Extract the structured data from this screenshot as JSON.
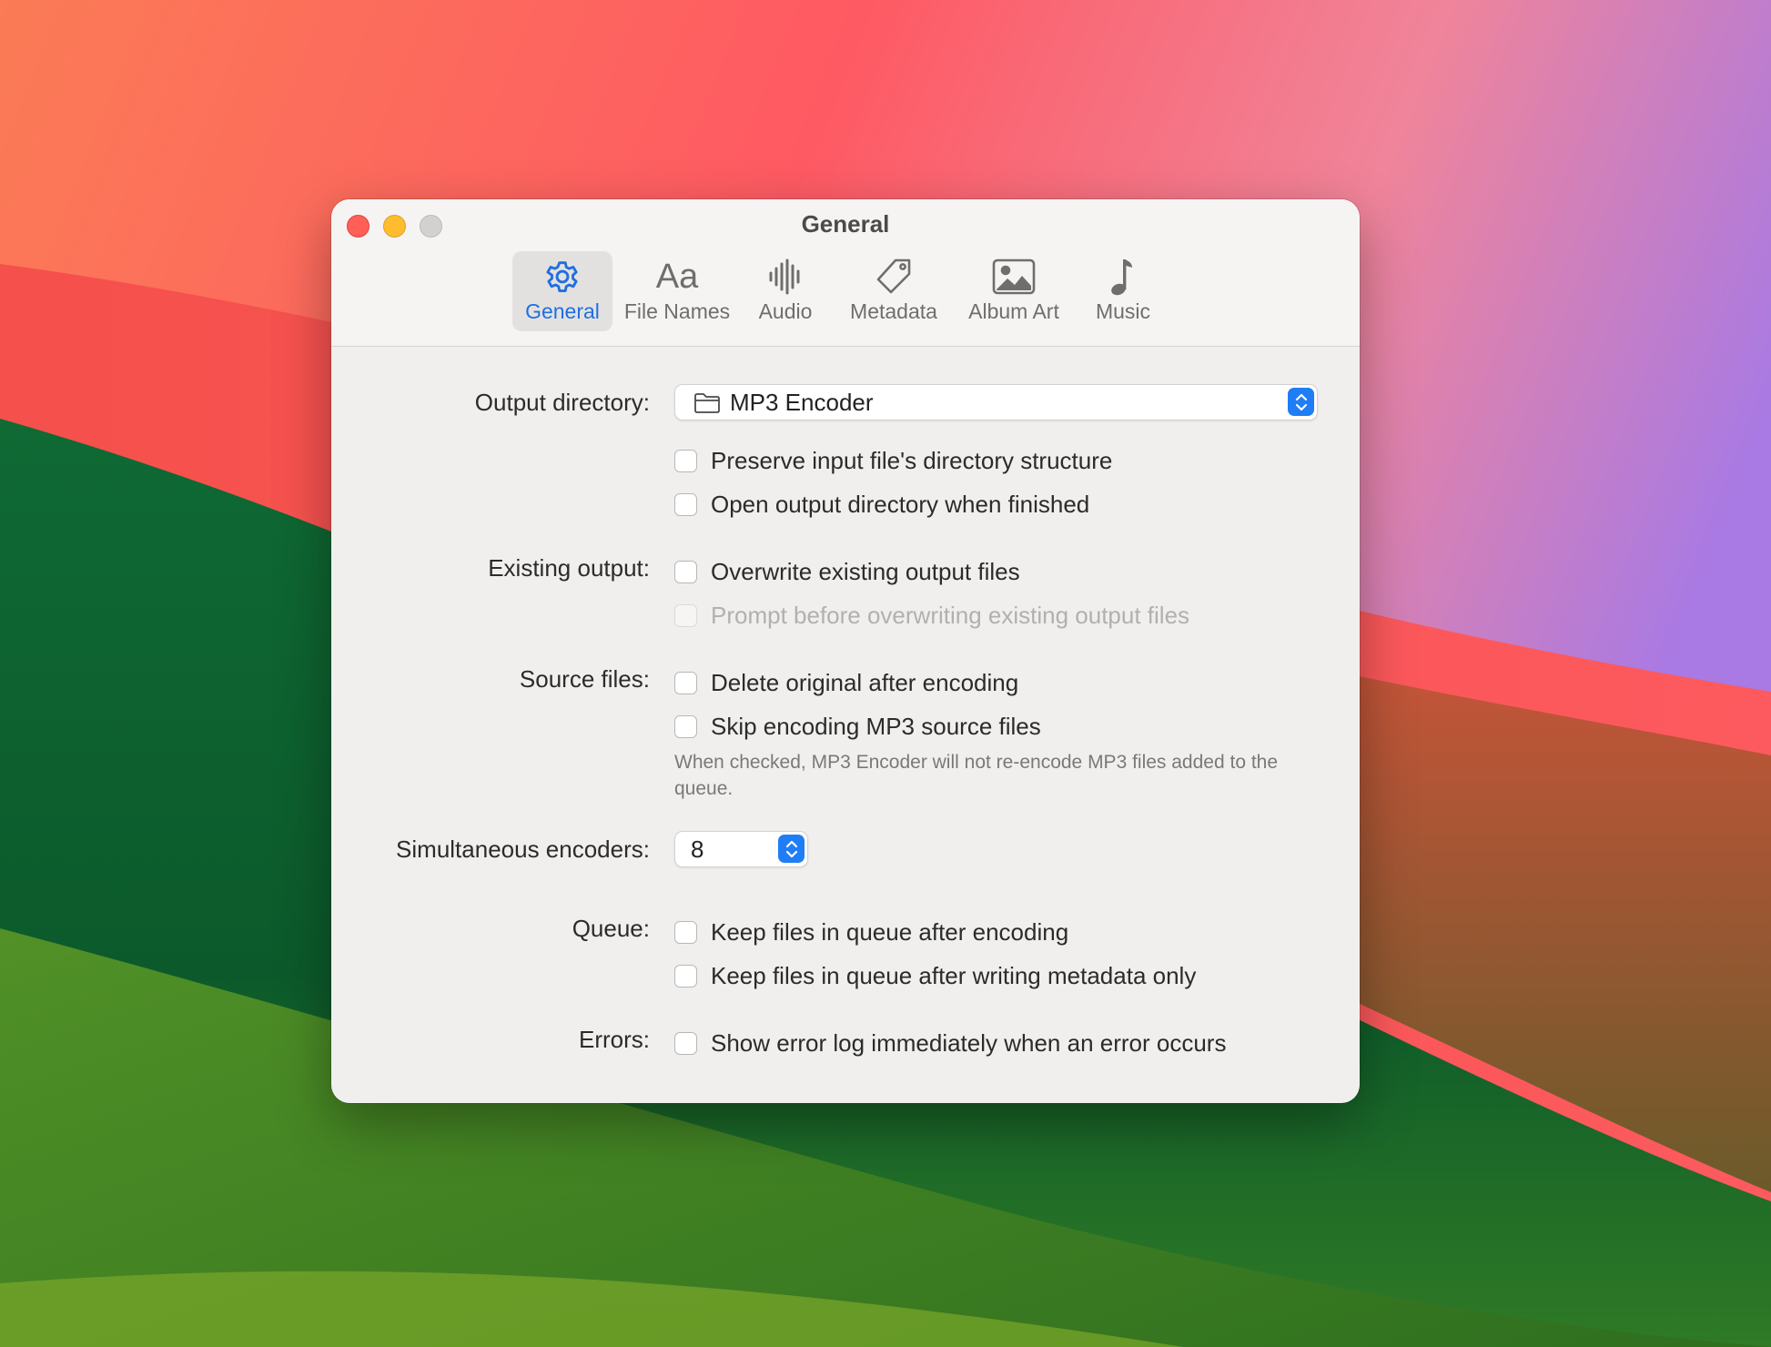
{
  "window": {
    "title": "General",
    "colors": {
      "accent": "#1f7df5",
      "close": "#fe5f57",
      "minimize": "#febc2e",
      "zoom": "#d3d1d0"
    }
  },
  "tabs": [
    {
      "label": "General",
      "icon": "gear-icon",
      "active": true
    },
    {
      "label": "File Names",
      "icon": "text-aa-icon",
      "active": false
    },
    {
      "label": "Audio",
      "icon": "waveform-icon",
      "active": false
    },
    {
      "label": "Metadata",
      "icon": "tag-icon",
      "active": false
    },
    {
      "label": "Album Art",
      "icon": "photo-icon",
      "active": false
    },
    {
      "label": "Music",
      "icon": "music-note-icon",
      "active": false
    }
  ],
  "output_directory": {
    "label": "Output directory:",
    "value": "MP3 Encoder",
    "preserve_structure": {
      "label": "Preserve input file's directory structure",
      "checked": false
    },
    "open_when_finished": {
      "label": "Open output directory when finished",
      "checked": false
    }
  },
  "existing_output": {
    "label": "Existing output:",
    "overwrite": {
      "label": "Overwrite existing output files",
      "checked": false
    },
    "prompt": {
      "label": "Prompt before overwriting existing output files",
      "checked": false,
      "enabled": false
    }
  },
  "source_files": {
    "label": "Source files:",
    "delete_original": {
      "label": "Delete original after encoding",
      "checked": false
    },
    "skip_mp3": {
      "label": "Skip encoding MP3 source files",
      "checked": false
    },
    "help_text": "When checked, MP3 Encoder will not re-encode MP3 files added to the queue."
  },
  "encoders": {
    "label": "Simultaneous encoders:",
    "value": "8"
  },
  "queue": {
    "label": "Queue:",
    "keep_after_encoding": {
      "label": "Keep files in queue after encoding",
      "checked": false
    },
    "keep_after_metadata": {
      "label": "Keep files in queue after writing metadata only",
      "checked": false
    }
  },
  "errors": {
    "label": "Errors:",
    "show_log": {
      "label": "Show error log immediately when an error occurs",
      "checked": false
    }
  }
}
